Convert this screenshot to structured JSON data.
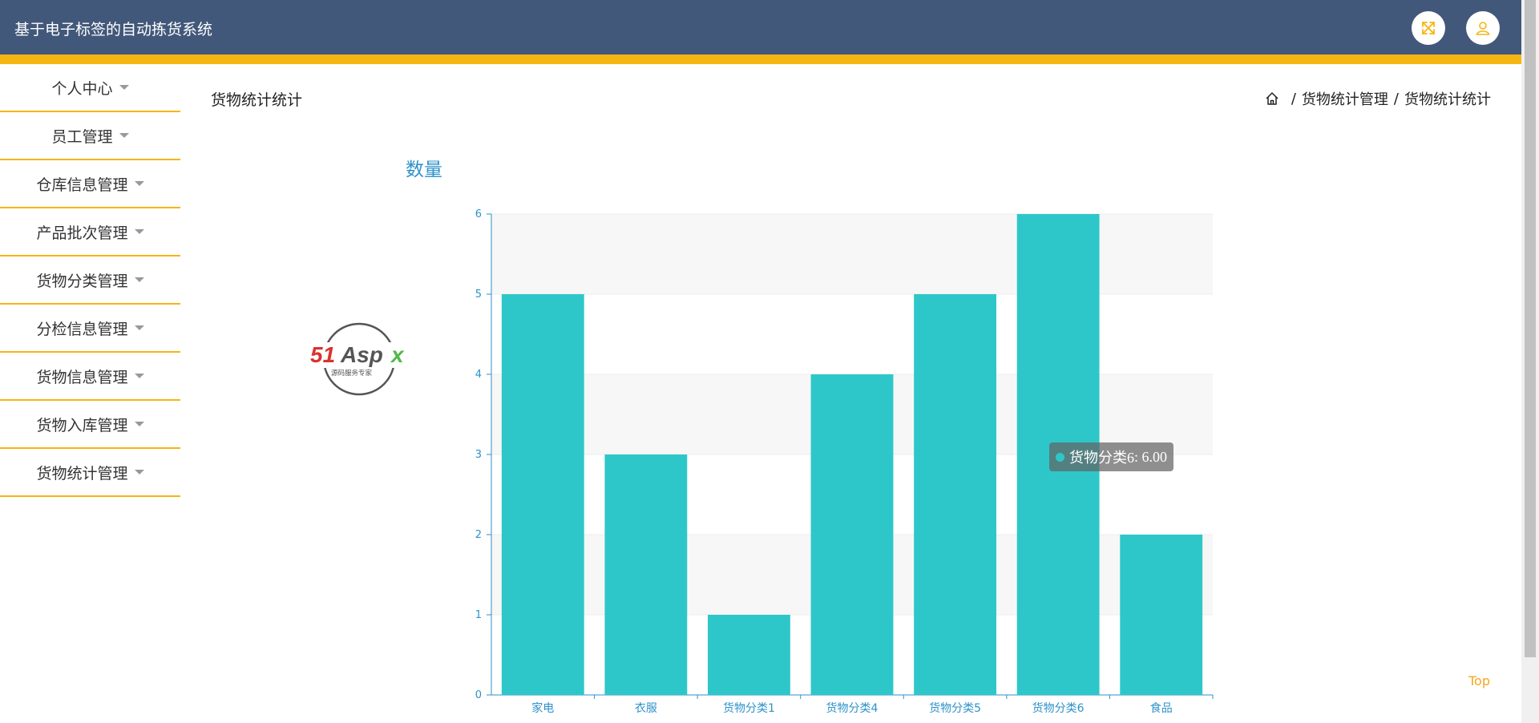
{
  "header": {
    "title": "基于电子标签的自动拣货系统",
    "fullscreen_icon": "fullscreen-icon",
    "user_icon": "user-icon",
    "bg_color": "#42587a",
    "accent_color": "#f7b512"
  },
  "sidebar": {
    "items": [
      {
        "label": "个人中心"
      },
      {
        "label": "员工管理"
      },
      {
        "label": "仓库信息管理"
      },
      {
        "label": "产品批次管理"
      },
      {
        "label": "货物分类管理"
      },
      {
        "label": "分检信息管理"
      },
      {
        "label": "货物信息管理"
      },
      {
        "label": "货物入库管理"
      },
      {
        "label": "货物统计管理"
      }
    ]
  },
  "main": {
    "page_title": "货物统计统计",
    "breadcrumb": [
      "货物统计管理",
      "货物统计统计"
    ],
    "breadcrumb_home_icon": "home-icon",
    "top_link": "Top"
  },
  "watermark": {
    "text": "51Aspx",
    "subtitle": "源码服务专家"
  },
  "tooltip": {
    "label": "货物分类6",
    "value": "6.00"
  },
  "chart_data": {
    "type": "bar",
    "title": "数量",
    "categories": [
      "家电",
      "衣服",
      "货物分类1",
      "货物分类4",
      "货物分类5",
      "货物分类6",
      "食品"
    ],
    "values": [
      5,
      3,
      1,
      4,
      5,
      6,
      2
    ],
    "ylim": [
      0,
      6
    ],
    "yticks": [
      0,
      1,
      2,
      3,
      4,
      5,
      6
    ],
    "grid": true,
    "bar_color": "#2ec7c9",
    "axis_color": "#2e92c9"
  }
}
